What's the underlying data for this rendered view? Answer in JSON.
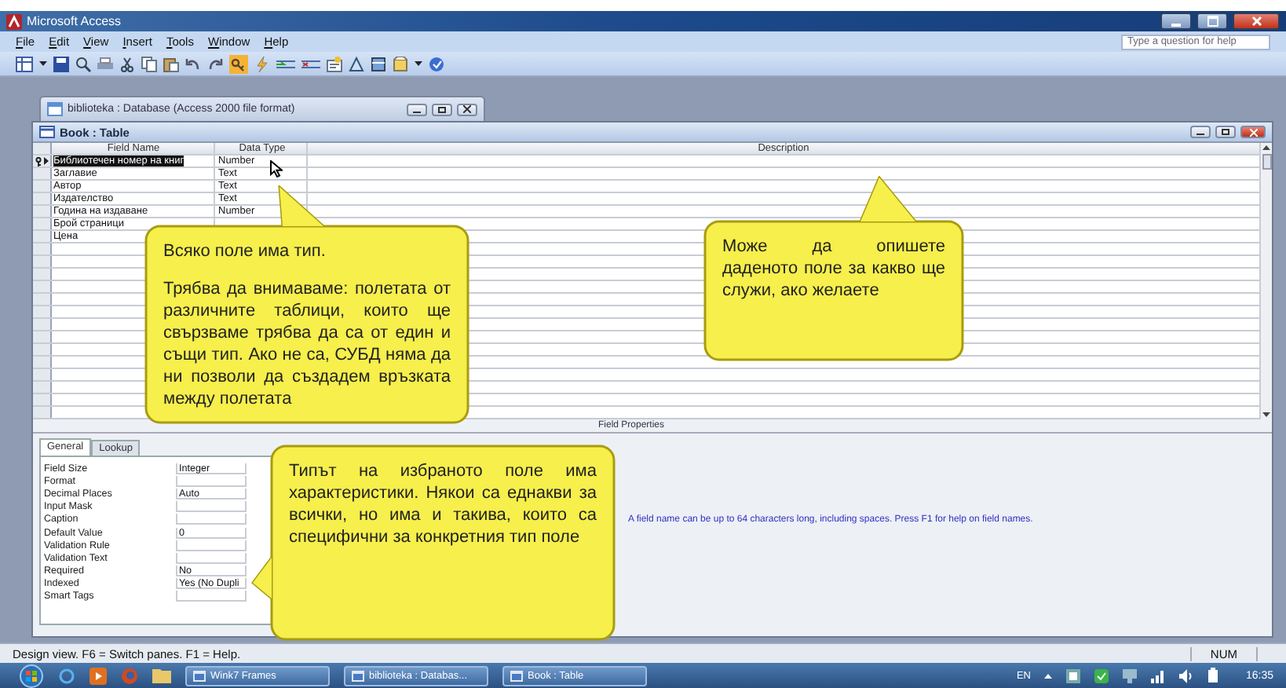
{
  "window": {
    "title": "Microsoft Access"
  },
  "menu": [
    "File",
    "Edit",
    "View",
    "Insert",
    "Tools",
    "Window",
    "Help"
  ],
  "help_box": {
    "placeholder": "Type a question for help"
  },
  "database_window": {
    "title": "biblioteka : Database (Access 2000 file format)"
  },
  "table_window": {
    "title": "Book : Table",
    "columns": [
      "Field Name",
      "Data Type",
      "Description"
    ],
    "rows": [
      {
        "field_name": "Библиотечен номер на книг",
        "data_type": "Number",
        "primary_key": true,
        "selected": true
      },
      {
        "field_name": "Заглавие",
        "data_type": "Text",
        "primary_key": false,
        "selected": false
      },
      {
        "field_name": "Автор",
        "data_type": "Text",
        "primary_key": false,
        "selected": false
      },
      {
        "field_name": "Издателство",
        "data_type": "Text",
        "primary_key": false,
        "selected": false
      },
      {
        "field_name": "Година на издаване",
        "data_type": "Number",
        "primary_key": false,
        "selected": false
      },
      {
        "field_name": "Брой страници",
        "primary_key": false,
        "selected": false
      },
      {
        "field_name": "Цена",
        "primary_key": false,
        "selected": false
      }
    ]
  },
  "field_properties": {
    "label": "Field Properties",
    "tabs": [
      {
        "label": "General",
        "selected": true
      },
      {
        "label": "Lookup",
        "selected": false
      }
    ],
    "properties": [
      {
        "name": "Field Size",
        "value": "Integer"
      },
      {
        "name": "Format"
      },
      {
        "name": "Decimal Places",
        "value": "Auto"
      },
      {
        "name": "Input Mask"
      },
      {
        "name": "Caption"
      },
      {
        "name": "Default Value",
        "value": "0"
      },
      {
        "name": "Validation Rule"
      },
      {
        "name": "Validation Text"
      },
      {
        "name": "Required",
        "value": "No"
      },
      {
        "name": "Indexed",
        "value": "Yes (No Dupli"
      },
      {
        "name": "Smart Tags"
      }
    ],
    "help_text": "A field name can be up to 64 characters long, including spaces.  Press F1 for help on field names."
  },
  "callouts": [
    {
      "paragraphs": [
        "Всяко поле има тип.",
        "Трябва да внимаваме: полетата от различните таблици, които ще свързваме трябва да са от един и същи тип. Ако не са, СУБД няма да ни позволи да създадем връзката между полетата"
      ]
    },
    {
      "paragraphs": [
        "Може да опишете даденото поле за какво ще служи, ако желаете"
      ]
    },
    {
      "paragraphs": [
        "Типът на избраното поле има характеристики. Някои са еднакви за всички, но има и такива, които са специфични за конкретния тип поле"
      ]
    }
  ],
  "status_bar": {
    "text": "Design view.  F6 = Switch panes.  F1 = Help.",
    "indicator": "NUM"
  },
  "taskbar": {
    "tasks": [
      {
        "label": "Wink7 Frames"
      },
      {
        "label": "biblioteka : Databas..."
      },
      {
        "label": "Book : Table"
      }
    ],
    "language": "EN",
    "clock": "16:35"
  }
}
